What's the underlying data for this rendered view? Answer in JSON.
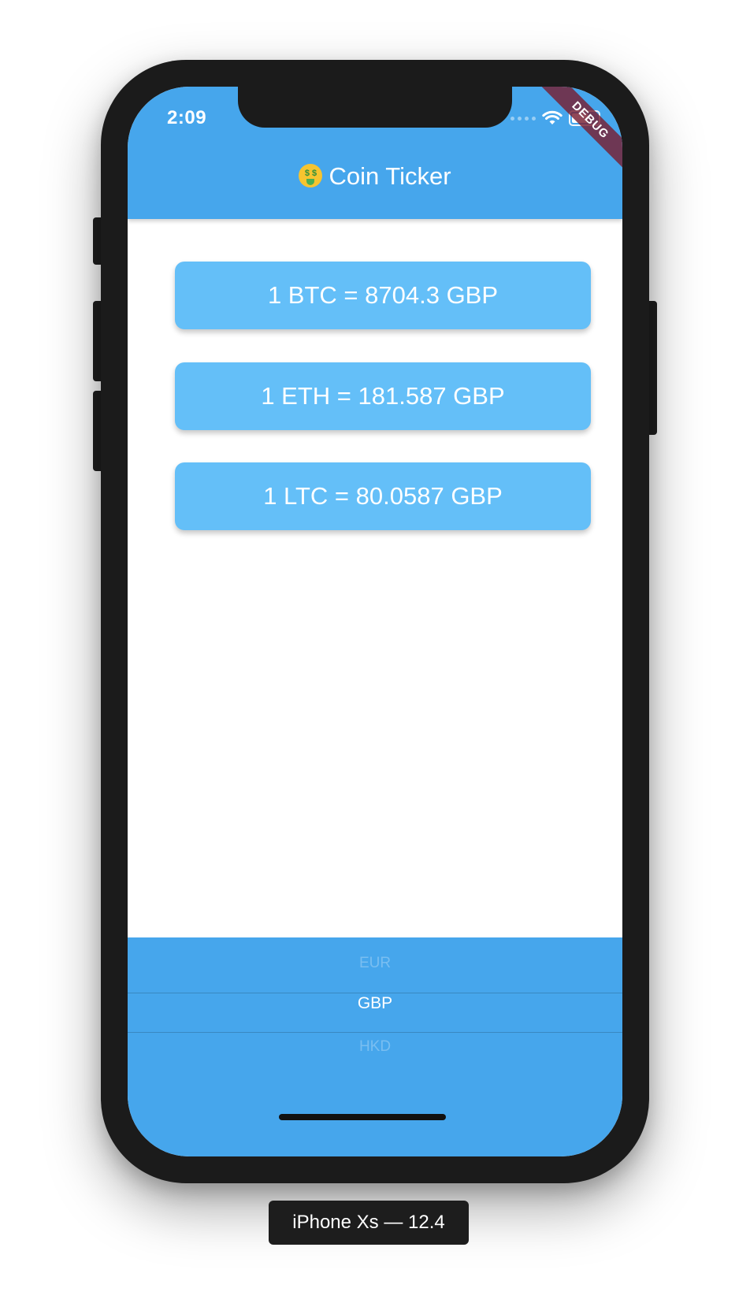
{
  "status_bar": {
    "time": "2:09",
    "icons": [
      "signal-dots-icon",
      "wifi-icon",
      "battery-icon"
    ]
  },
  "debug_banner": "DEBUG",
  "app_bar": {
    "emoji": "money-mouth-face-icon",
    "title": "Coin Ticker",
    "color": "#46a6ec"
  },
  "rates": [
    {
      "text": "1 BTC = 8704.3 GBP"
    },
    {
      "text": "1 ETH = 181.587 GBP"
    },
    {
      "text": "1 LTC = 80.0587 GBP"
    }
  ],
  "card_color": "#64bff8",
  "currency_picker": {
    "previous": "EUR",
    "selected": "GBP",
    "next": "HKD"
  },
  "device_label": "iPhone Xs — 12.4"
}
